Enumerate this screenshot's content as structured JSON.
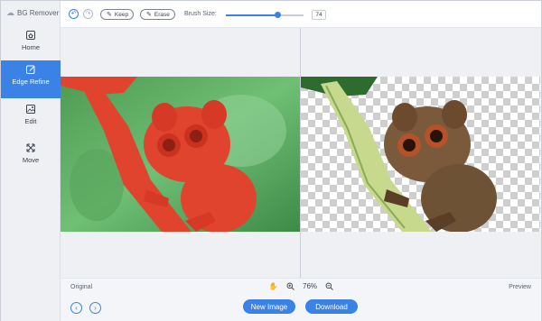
{
  "app": {
    "title": "BG Remover"
  },
  "sidebar": {
    "items": [
      {
        "label": "Home",
        "icon": "home-icon",
        "active": false
      },
      {
        "label": "Edge Refine",
        "icon": "edit-square-icon",
        "active": true
      },
      {
        "label": "Edit",
        "icon": "image-edit-icon",
        "active": false
      },
      {
        "label": "Move",
        "icon": "move-arrows-icon",
        "active": false
      }
    ]
  },
  "toolbar": {
    "keep_label": "Keep",
    "erase_label": "Erase",
    "brush_size_label": "Brush Size:",
    "brush_size_value": "74",
    "brush_fraction": 0.66
  },
  "status": {
    "original_label": "Original",
    "preview_label": "Preview",
    "zoom": "76%"
  },
  "actions": {
    "new_image_label": "New Image",
    "download_label": "Download"
  },
  "colors": {
    "accent": "#3b82e6",
    "mask_red": "#e0432e"
  }
}
